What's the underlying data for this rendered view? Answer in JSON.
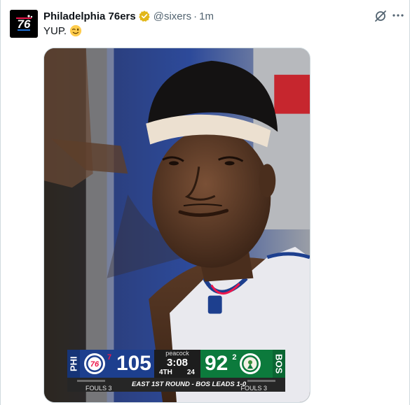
{
  "tweet": {
    "account": {
      "display_name": "Philadelphia 76ers",
      "handle": "@sixers",
      "time": "1m",
      "separator": "·",
      "avatar_icon": "sixers-logo-icon",
      "verified_icon": "verified-gold-badge-icon"
    },
    "text": "YUP.",
    "emoji": "winking-face-emoji",
    "actions": {
      "grok_icon": "grok-icon",
      "more_icon": "more-options-icon"
    }
  },
  "media": {
    "scorebug": {
      "home_abbr": "PHI",
      "home_seed": "7",
      "home_score": "105",
      "network": "peacock",
      "clock": "3:08",
      "period": "4TH",
      "shot_clock": "24",
      "away_score": "92",
      "away_seed": "2",
      "away_abbr": "BOS",
      "fouls_left": "FOULS 3",
      "fouls_right": "FOULS 3",
      "series_text": "EAST 1ST ROUND - BOS LEADS 1-0"
    }
  },
  "colors": {
    "phi_blue": "#1d3f8e",
    "phi_red": "#ed174c",
    "bos_green": "#0c7a3c",
    "verified_gold": "#e2b719"
  }
}
